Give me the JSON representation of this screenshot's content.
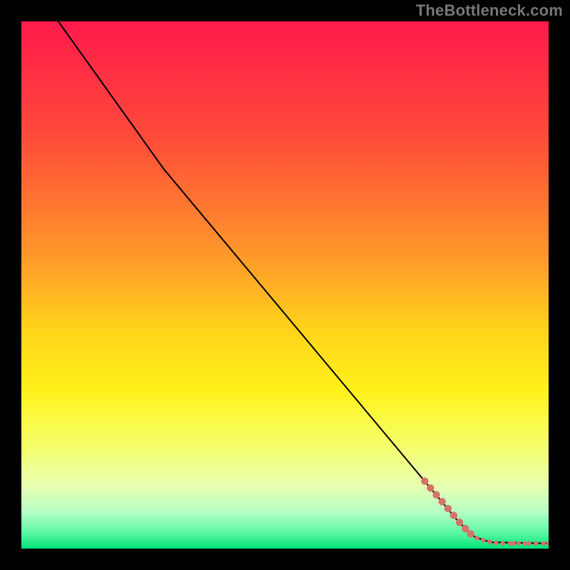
{
  "watermark": "TheBottleneck.com",
  "chart_data": {
    "type": "line",
    "title": "",
    "xlabel": "",
    "ylabel": "",
    "xlim": [
      0,
      100
    ],
    "ylim": [
      0,
      100
    ],
    "background_gradient": {
      "stops": [
        {
          "offset": 0,
          "color": "#ff1a4b"
        },
        {
          "offset": 22,
          "color": "#ff4b3a"
        },
        {
          "offset": 45,
          "color": "#ff9a2a"
        },
        {
          "offset": 58,
          "color": "#ffd21a"
        },
        {
          "offset": 70,
          "color": "#fff21a"
        },
        {
          "offset": 80,
          "color": "#f6ff66"
        },
        {
          "offset": 88,
          "color": "#e8ffb0"
        },
        {
          "offset": 93,
          "color": "#b7ffc6"
        },
        {
          "offset": 97,
          "color": "#5cf7a4"
        },
        {
          "offset": 100,
          "color": "#00e27a"
        }
      ]
    },
    "series": [
      {
        "name": "curve",
        "type": "line",
        "color": "#000000",
        "width": 2,
        "points": [
          {
            "x": 7,
            "y": 100
          },
          {
            "x": 27,
            "y": 72
          },
          {
            "x": 83,
            "y": 5
          },
          {
            "x": 86,
            "y": 2.2
          },
          {
            "x": 89,
            "y": 1.2
          },
          {
            "x": 100,
            "y": 1.0
          }
        ]
      },
      {
        "name": "markers",
        "type": "scatter",
        "color": "#d57468",
        "radius_small": 3.2,
        "radius_large": 5.2,
        "points": [
          {
            "x": 76.5,
            "y": 12.8,
            "r": "large"
          },
          {
            "x": 77.6,
            "y": 11.5,
            "r": "large"
          },
          {
            "x": 78.7,
            "y": 10.2,
            "r": "large"
          },
          {
            "x": 79.8,
            "y": 8.9,
            "r": "large"
          },
          {
            "x": 80.9,
            "y": 7.6,
            "r": "large"
          },
          {
            "x": 82.0,
            "y": 6.3,
            "r": "large"
          },
          {
            "x": 83.1,
            "y": 5.0,
            "r": "large"
          },
          {
            "x": 84.2,
            "y": 3.8,
            "r": "large"
          },
          {
            "x": 85.2,
            "y": 2.8,
            "r": "large"
          },
          {
            "x": 86.4,
            "y": 2.0,
            "r": "small"
          },
          {
            "x": 87.6,
            "y": 1.6,
            "r": "small"
          },
          {
            "x": 88.8,
            "y": 1.3,
            "r": "small"
          },
          {
            "x": 90.0,
            "y": 1.1,
            "r": "small"
          },
          {
            "x": 91.3,
            "y": 1.0,
            "r": "small"
          },
          {
            "x": 92.7,
            "y": 1.0,
            "r": "small"
          },
          {
            "x": 93.3,
            "y": 1.0,
            "r": "small"
          },
          {
            "x": 94.3,
            "y": 1.0,
            "r": "small"
          },
          {
            "x": 95.5,
            "y": 1.0,
            "r": "small"
          },
          {
            "x": 96.3,
            "y": 1.0,
            "r": "small"
          },
          {
            "x": 97.6,
            "y": 1.0,
            "r": "small"
          },
          {
            "x": 99.0,
            "y": 1.0,
            "r": "small"
          },
          {
            "x": 100.0,
            "y": 1.0,
            "r": "small"
          }
        ]
      }
    ]
  }
}
